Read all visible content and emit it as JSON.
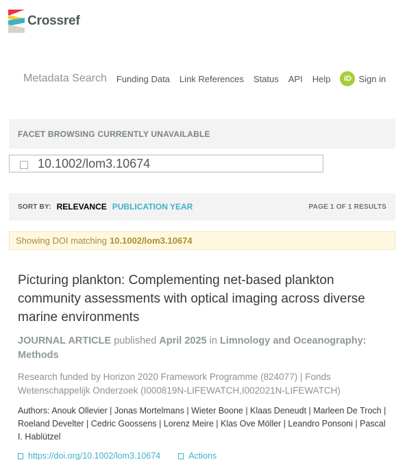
{
  "header": {
    "logo_text": "Crossref"
  },
  "nav": {
    "brand": "Metadata Search",
    "items": [
      "Funding Data",
      "Link References",
      "Status",
      "API",
      "Help"
    ],
    "orcid_label": "iD",
    "signin": "Sign in"
  },
  "facets": {
    "notice": "FACET BROWSING CURRENTLY UNAVAILABLE"
  },
  "search": {
    "value": "10.1002/lom3.10674"
  },
  "sort": {
    "label": "SORT BY:",
    "relevance": "RELEVANCE",
    "publication_year": "PUBLICATION YEAR",
    "page_info": "PAGE 1 OF 1 RESULTS"
  },
  "notice": {
    "prefix": "Showing DOI matching",
    "doi": "10.1002/lom3.10674"
  },
  "result": {
    "title": "Picturing plankton: Complementing net-based plankton community assessments with optical imaging across diverse marine environments",
    "type": "JOURNAL ARTICLE",
    "published_word": "published",
    "date": "April 2025",
    "in_word": "in",
    "journal": "Limnology and Oceanography: Methods",
    "funding": "Research funded by Horizon 2020 Framework Programme (824077) | Fonds Wetenschappelijk Onderzoek (I000819N-LIFEWATCH,I002021N-LIFEWATCH)",
    "authors": "Authors: Anouk Ollevier | Jonas Mortelmans | Wieter Boone | Klaas Deneudt | Marleen De Troch | Roeland Develter | Cedric Goossens | Lorenz Meire | Klas Ove Möller | Leandro Ponsoni | Pascal I. Hablützel",
    "doi_link": "https://doi.org/10.1002/lom3.10674",
    "actions": "Actions"
  },
  "colors": {
    "accent": "#3eb1c8",
    "text": "#4f5858",
    "orcid": "#a6ce39",
    "notice_bg": "#fff8e1"
  }
}
